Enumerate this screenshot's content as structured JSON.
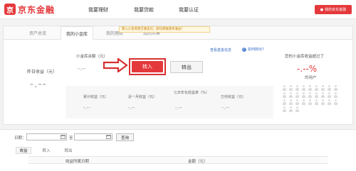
{
  "header": {
    "logo_mark": "京",
    "logo_text": "京东金融",
    "nav": [
      "我要理财",
      "我要贷款",
      "我要认证"
    ],
    "account_button": "我的京东金融"
  },
  "tabs": [
    "资产总览",
    "我的小金库",
    "我的理财",
    "我的众筹"
  ],
  "yesterday": {
    "label": "昨日收益（元）",
    "value": "-.--"
  },
  "balance": {
    "label": "小金库余额（元）",
    "value": "-.--"
  },
  "tooltip": "转入小金库更方便支付，即日转账更享收益！",
  "actions": {
    "transfer_in": "转入",
    "transfer_out": "转出"
  },
  "top_links": {
    "funds": "查看基金信息",
    "how_to_transfer": "如何转出?"
  },
  "stats": [
    {
      "label": "累计收益（元）",
      "value": "-.--"
    },
    {
      "label": "近一月收益（元）",
      "value": "-.--"
    },
    {
      "label": "七日年化收益率（%）",
      "value": "-.--"
    },
    {
      "label": "万份收益（元）",
      "value": "-.--"
    }
  ],
  "side": {
    "title": "您的小金库收益超过了",
    "percent": "-.--%",
    "suffix": "的用户"
  },
  "filter": {
    "date_label": "日期：",
    "separator": "至",
    "query_button": "查询"
  },
  "subtabs": [
    "收益",
    "转入",
    "转出"
  ],
  "table_headers": [
    "收益所属日期",
    "金额（元）"
  ],
  "colors": {
    "brand_red": "#e4393c",
    "annotation_red": "#d83030"
  }
}
